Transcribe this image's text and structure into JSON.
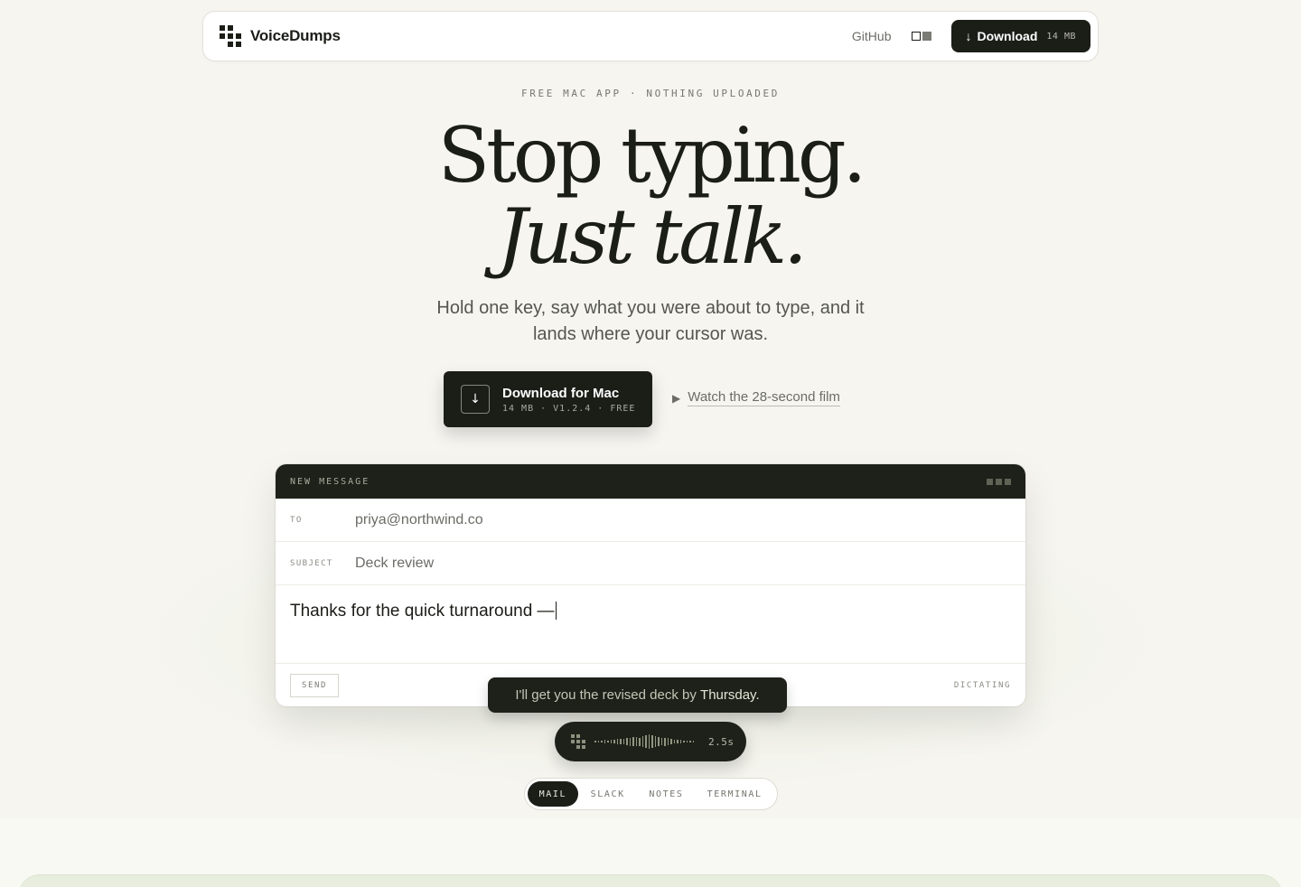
{
  "nav": {
    "brand": "VoiceDumps",
    "github": "GitHub",
    "download_label": "Download",
    "download_size": "14 MB"
  },
  "hero": {
    "eyebrow": "FREE MAC APP · NOTHING UPLOADED",
    "line1": "Stop typing.",
    "line2": "Just talk.",
    "subtitle": "Hold one key, say what you were about to type, and it lands where your cursor was.",
    "cta_title": "Download for Mac",
    "cta_meta": "14 MB · V1.2.4 · FREE",
    "film_label": "Watch the 28-second film"
  },
  "mail": {
    "header": "NEW MESSAGE",
    "to_label": "TO",
    "to_value": "priya@northwind.co",
    "subject_label": "SUBJECT",
    "subject_value": "Deck review",
    "body": "Thanks for the quick turnaround —",
    "send_label": "SEND",
    "status": "DICTATING"
  },
  "dictation": {
    "bubble_text": "I'll get you the revised deck by",
    "bubble_highlight": "Thursday.",
    "duration": "2.5s",
    "wave_levels": [
      0.1,
      0.15,
      0.1,
      0.2,
      0.15,
      0.25,
      0.2,
      0.3,
      0.35,
      0.3,
      0.4,
      0.5,
      0.55,
      0.6,
      0.5,
      0.7,
      0.8,
      0.9,
      0.75,
      0.65,
      0.55,
      0.45,
      0.5,
      0.4,
      0.3,
      0.25,
      0.2,
      0.25,
      0.15,
      0.1,
      0.15,
      0.1
    ]
  },
  "tabs": [
    {
      "label": "MAIL",
      "active": true
    },
    {
      "label": "SLACK",
      "active": false
    },
    {
      "label": "NOTES",
      "active": false
    },
    {
      "label": "TERMINAL",
      "active": false
    }
  ],
  "colors": {
    "background": "#f6f5f0",
    "ink": "#1b1d17",
    "dark_panel": "#1e2119",
    "accent_green": "#e7eedd"
  }
}
